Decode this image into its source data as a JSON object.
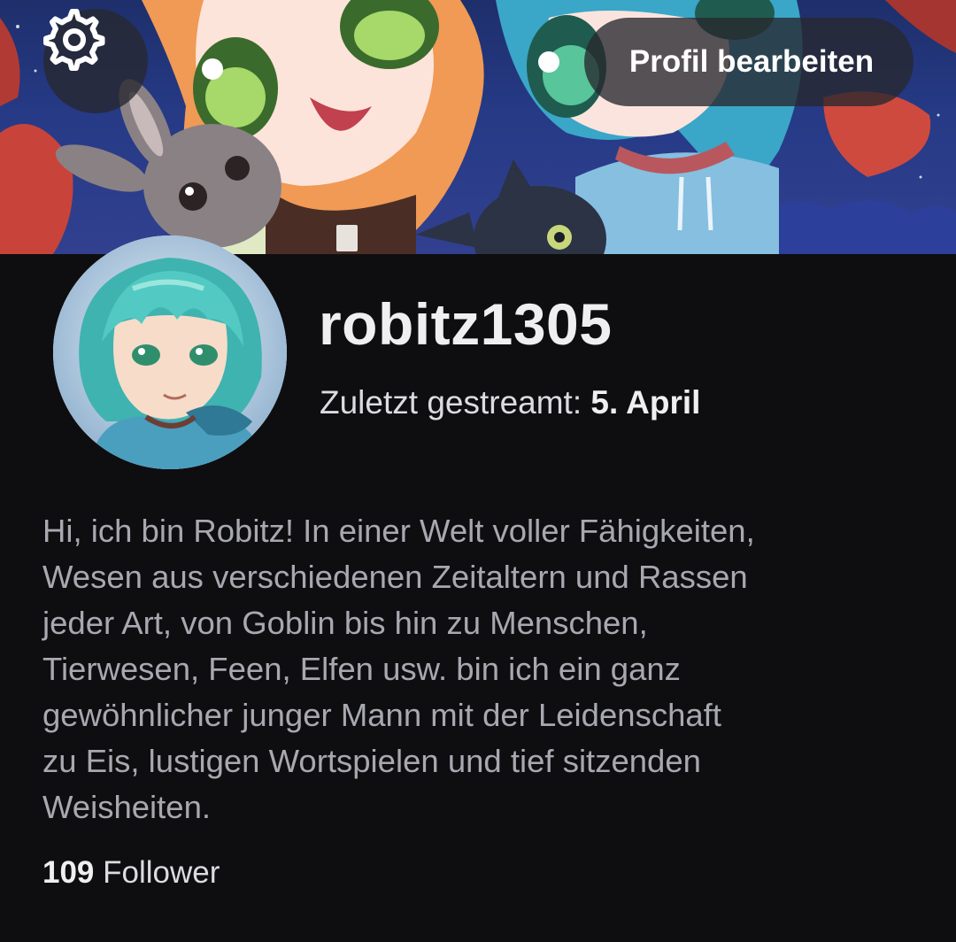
{
  "header": {
    "settings_icon": "gear-icon",
    "edit_profile_label": "Profil bearbeiten"
  },
  "profile": {
    "username": "robitz1305",
    "last_streamed_label": "Zuletzt gestreamt: ",
    "last_streamed_date": "5. April",
    "bio_lines": [
      "Hi, ich bin Robitz! In einer Welt voller Fähigkeiten,",
      "Wesen aus verschiedenen Zeitaltern und Rassen",
      "jeder Art, von Goblin bis hin zu Menschen,",
      "Tierwesen, Feen, Elfen usw. bin ich ein ganz",
      "gewöhnlicher junger Mann mit der Leidenschaft",
      "zu Eis, lustigen Wortspielen und tief sitzenden",
      "Weisheiten."
    ],
    "follower_count": "109",
    "follower_label": " Follower"
  },
  "colors": {
    "background": "#0e0e10",
    "text_primary": "#efeff1",
    "text_secondary": "#a8a8b0",
    "button_overlay": "#28282e"
  }
}
